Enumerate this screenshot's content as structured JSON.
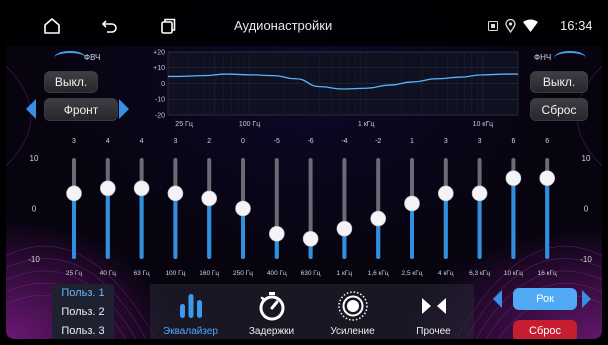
{
  "status_bar": {
    "title": "Аудионастройки",
    "time": "16:34",
    "icons": [
      "home-icon",
      "back-icon",
      "recents-icon",
      "sim-icon",
      "location-icon",
      "wifi-icon"
    ]
  },
  "left_panel": {
    "hpf_label": "ФВЧ",
    "off_label": "Выкл.",
    "position_label": "Фронт"
  },
  "right_panel": {
    "lpf_label": "ФНЧ",
    "off_label": "Выкл.",
    "reset_label": "Сброс"
  },
  "frequency_response": {
    "y_ticks": [
      "+20",
      "+10",
      "0",
      "-10",
      "-20"
    ],
    "x_ticks": [
      "25 Гц",
      "100 Гц",
      "1 кГц",
      "10 кГц"
    ],
    "curve": [
      [
        25,
        4.5
      ],
      [
        40,
        5.0
      ],
      [
        63,
        6.0
      ],
      [
        100,
        5.5
      ],
      [
        160,
        5.0
      ],
      [
        250,
        3.0
      ],
      [
        400,
        -2.0
      ],
      [
        630,
        -3.5
      ],
      [
        1000,
        -3.0
      ],
      [
        1600,
        -1.0
      ],
      [
        2500,
        1.0
      ],
      [
        4000,
        3.0
      ],
      [
        6300,
        4.0
      ],
      [
        10000,
        5.5
      ],
      [
        16000,
        6.0
      ]
    ]
  },
  "equalizer": {
    "scale_top": "10",
    "scale_mid": "0",
    "scale_bottom": "-10",
    "range": [
      -10,
      10
    ],
    "bands": [
      {
        "freq": "25 Гц",
        "value": 3
      },
      {
        "freq": "40 Гц",
        "value": 4
      },
      {
        "freq": "63 Гц",
        "value": 4
      },
      {
        "freq": "100 Гц",
        "value": 3
      },
      {
        "freq": "160 Гц",
        "value": 2
      },
      {
        "freq": "250 Гц",
        "value": 0
      },
      {
        "freq": "400 Гц",
        "value": -5
      },
      {
        "freq": "630 Гц",
        "value": -6
      },
      {
        "freq": "1 кГц",
        "value": -4
      },
      {
        "freq": "1,6 кГц",
        "value": -2
      },
      {
        "freq": "2,5 кГц",
        "value": 1
      },
      {
        "freq": "4 кГц",
        "value": 3
      },
      {
        "freq": "6,3 кГц",
        "value": 3
      },
      {
        "freq": "10 кГц",
        "value": 6
      },
      {
        "freq": "16 кГц",
        "value": 6
      }
    ]
  },
  "presets": [
    "Польз. 1",
    "Польз. 2",
    "Польз. 3"
  ],
  "tabs": [
    {
      "label": "Эквалайзер",
      "icon": "equalizer-icon",
      "active": true
    },
    {
      "label": "Задержки",
      "icon": "timer-icon",
      "active": false
    },
    {
      "label": "Усиление",
      "icon": "gain-knob-icon",
      "active": false
    },
    {
      "label": "Прочее",
      "icon": "other-icon",
      "active": false
    }
  ],
  "preset_selector": {
    "current": "Рок",
    "reset_label": "Сброс"
  },
  "colors": {
    "accent_blue": "#3a8ee6",
    "slider_fill": "#2f8fe0",
    "reset_red": "#c61d31",
    "curve": "#5ab4ff"
  }
}
